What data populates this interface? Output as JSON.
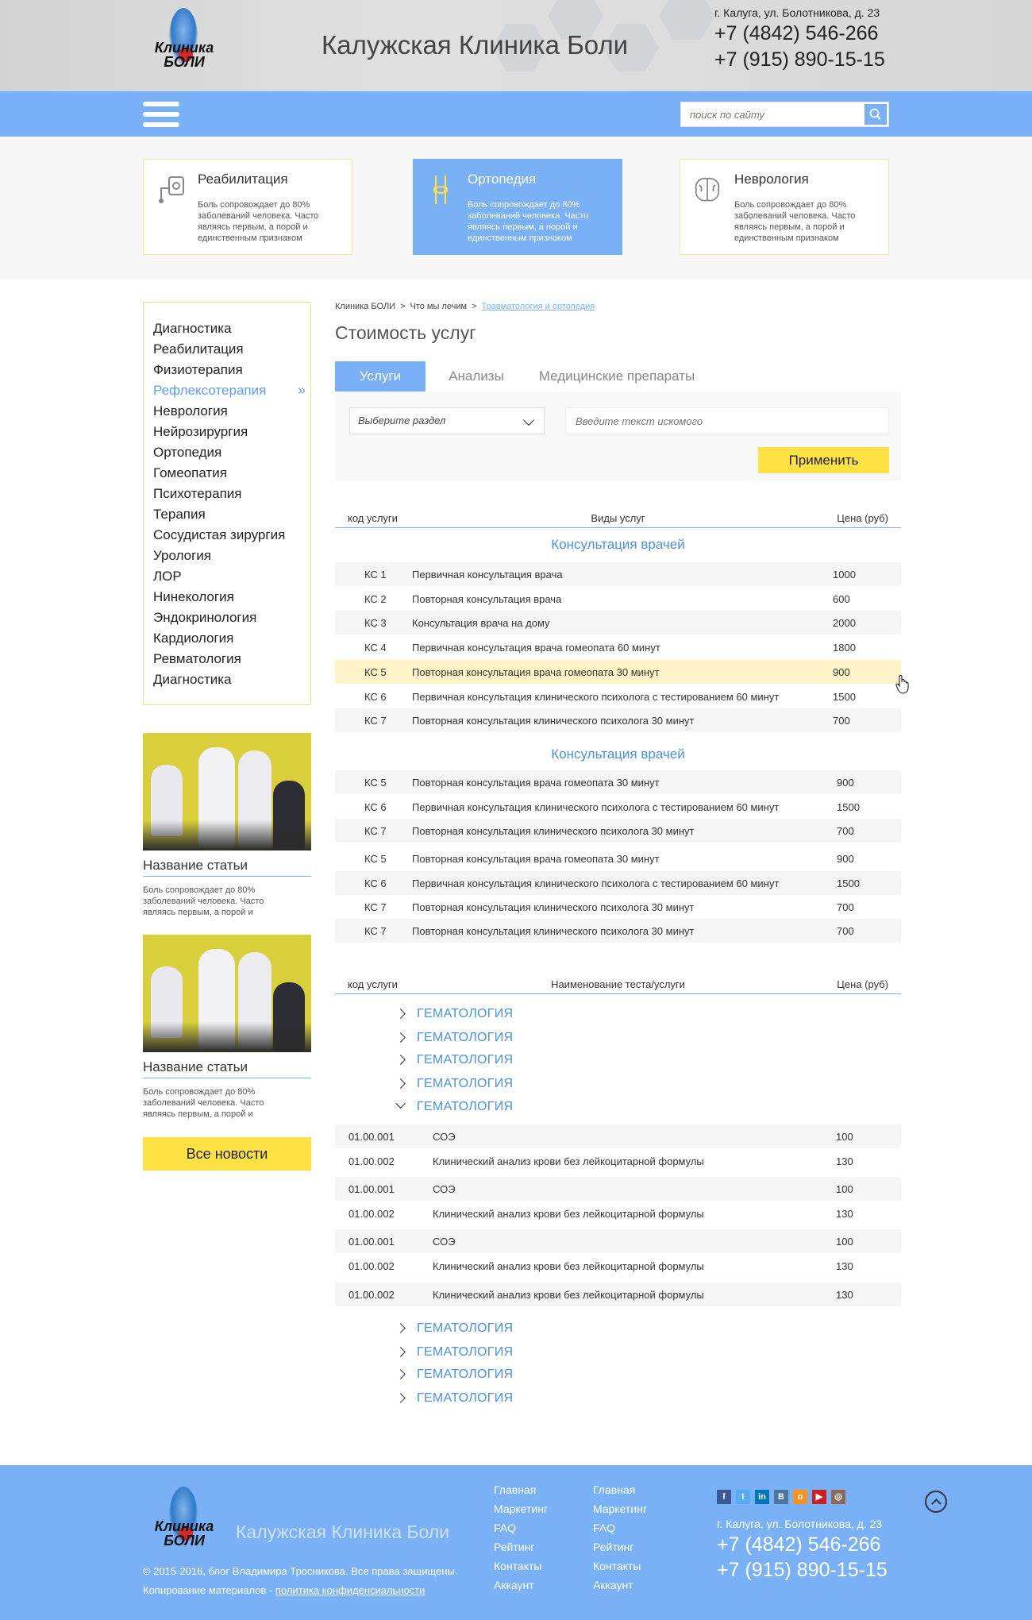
{
  "header": {
    "logo_text_1": "Клиника",
    "logo_text_2": "БОЛИ",
    "title": "Калужская Клиника Боли",
    "address": "г. Калуга, ул. Болотникова, д. 23",
    "phone_1": "+7 (4842) 546-266",
    "phone_2": "+7 (915) 890-15-15"
  },
  "search": {
    "placeholder": "поиск по сайту"
  },
  "cards": [
    {
      "title": "Реабилитация",
      "text": "Боль сопровождает до 80% заболеваний человека. Часто являясь первым, а порой и единственным признаком"
    },
    {
      "title": "Ортопедия",
      "text": "Боль сопровождает до 80% заболеваний человека. Часто являясь первым, а порой и единственным признаком"
    },
    {
      "title": "Неврология",
      "text": "Боль сопровождает до 80% заболеваний человека. Часто являясь первым, а порой и единственным признаком"
    }
  ],
  "sidebar": {
    "items": [
      "Диагностика",
      "Реабилитация",
      "Физиотерапия",
      "Рефлексотерапия",
      "Неврология",
      "Нейрозирургия",
      "Ортопедия",
      "Гомеопатия",
      "Психотерапия",
      "Терапия",
      "Сосудистая зирургия",
      "Урология",
      "ЛОР",
      "Нинекология",
      "Эндокринология",
      "Кардиология",
      "Ревматология",
      "Диагностика"
    ],
    "current": "Рефлексотерапия"
  },
  "articles": [
    {
      "title": "Название статьи",
      "text": "Боль сопровождает до 80% заболеваний человека. Часто являясь первым, а порой и"
    },
    {
      "title": "Название статьи",
      "text": "Боль сопровождает до 80% заболеваний человека. Часто являясь первым, а порой и"
    }
  ],
  "all_news": "Все новости",
  "breadcrumb": [
    "Клиника БОЛИ",
    ">",
    "Что мы лечим",
    ">",
    "Травматология и ортопедия"
  ],
  "page_title": "Стоимость услуг",
  "tabs": [
    "Услуги",
    "Анализы",
    "Медицинские препараты"
  ],
  "filter": {
    "section_placeholder": "Выберите раздел",
    "text_placeholder": "Введите текст искомого",
    "apply": "Применить"
  },
  "services_table": {
    "headers": [
      "код услуги",
      "Виды услуг",
      "Цена (руб)"
    ],
    "groups": [
      {
        "title": "Консультация врачей",
        "rows": [
          [
            "КС 1",
            "Первичная консультация врача",
            "1000"
          ],
          [
            "КС 2",
            "Повторная консультация врача",
            "600"
          ],
          [
            "КС 3",
            "Консультация врача на дому",
            "2000"
          ],
          [
            "КС 4",
            "Первичная консультация врача гомеопата 60 минут",
            "1800"
          ],
          [
            "КС 5",
            "Повторная консультация врача  гомеопата 30 минут",
            "900"
          ],
          [
            "КС 6",
            "Первичная консультация клинического психолога с тестированием 60 минут",
            "1500"
          ],
          [
            "КС 7",
            "Повторная консультация клинического психолога 30 минут",
            "700"
          ]
        ]
      },
      {
        "title": "Консультация врачей",
        "rows": [
          [
            "КС 5",
            "Повторная консультация врача  гомеопата 30 минут",
            "900"
          ],
          [
            "КС 6",
            "Первичная консультация клинического психолога с тестированием 60 минут",
            "1500"
          ],
          [
            "КС 7",
            "Повторная консультация клинического психолога 30 минут",
            "700"
          ],
          [
            "КС 5",
            "Повторная консультация врача  гомеопата 30 минут",
            "900"
          ],
          [
            "КС 6",
            "Первичная консультация клинического психолога с тестированием 60 минут",
            "1500"
          ],
          [
            "КС 7",
            "Повторная консультация клинического психолога 30 минут",
            "700"
          ],
          [
            "КС 7",
            "Повторная консультация клинического психолога 30 минут",
            "700"
          ]
        ]
      }
    ]
  },
  "tests_table": {
    "headers": [
      "код услуги",
      "Наименование теста/услуги",
      "Цена (руб)"
    ],
    "categories_before": [
      "ГЕМАТОЛОГИЯ",
      "ГЕМАТОЛОГИЯ",
      "ГЕМАТОЛОГИЯ",
      "ГЕМАТОЛОГИЯ"
    ],
    "open_category": "ГЕМАТОЛОГИЯ",
    "rows": [
      [
        "01.00.001",
        "СОЭ",
        "100"
      ],
      [
        "01.00.002",
        "Клинический анализ крови без лейкоцитарной формулы",
        "130"
      ],
      [
        "01.00.001",
        "СОЭ",
        "100"
      ],
      [
        "01.00.002",
        "Клинический анализ крови без лейкоцитарной формулы",
        "130"
      ],
      [
        "01.00.001",
        "СОЭ",
        "100"
      ],
      [
        "01.00.002",
        "Клинический анализ крови без лейкоцитарной формулы",
        "130"
      ],
      [
        "01.00.002",
        "Клинический анализ крови без лейкоцитарной формулы",
        "130"
      ]
    ],
    "categories_after": [
      "ГЕМАТОЛОГИЯ",
      "ГЕМАТОЛОГИЯ",
      "ГЕМАТОЛОГИЯ",
      "ГЕМАТОЛОГИЯ"
    ]
  },
  "footer": {
    "title": "Калужская Клиника Боли",
    "copyright": "© 2015-2016, блог Владимира Тросникова. Все права защищены.",
    "copy_note": "Копирование материалов - ",
    "privacy": "политика конфиденсиальности",
    "col1": [
      "Главная",
      "Маркетинг",
      "FAQ",
      "Рейтинг",
      "Контакты",
      "Аккаунт"
    ],
    "col2": [
      "Главная",
      "Маркетинг",
      "FAQ",
      "Рейтинг",
      "Контакты",
      "Аккаунт"
    ],
    "social": [
      "f",
      "t",
      "in",
      "В",
      "о",
      "▶",
      "◎"
    ],
    "address": "г. Калуга, ул. Болотникова, д. 23",
    "phone_1": "+7 (4842) 546-266",
    "phone_2": "+7 (915) 890-15-15"
  },
  "colors": {
    "accent": "#79b0f7",
    "yellow": "#fee142",
    "highlight": "#fef4c8",
    "link": "#4a90e2"
  }
}
